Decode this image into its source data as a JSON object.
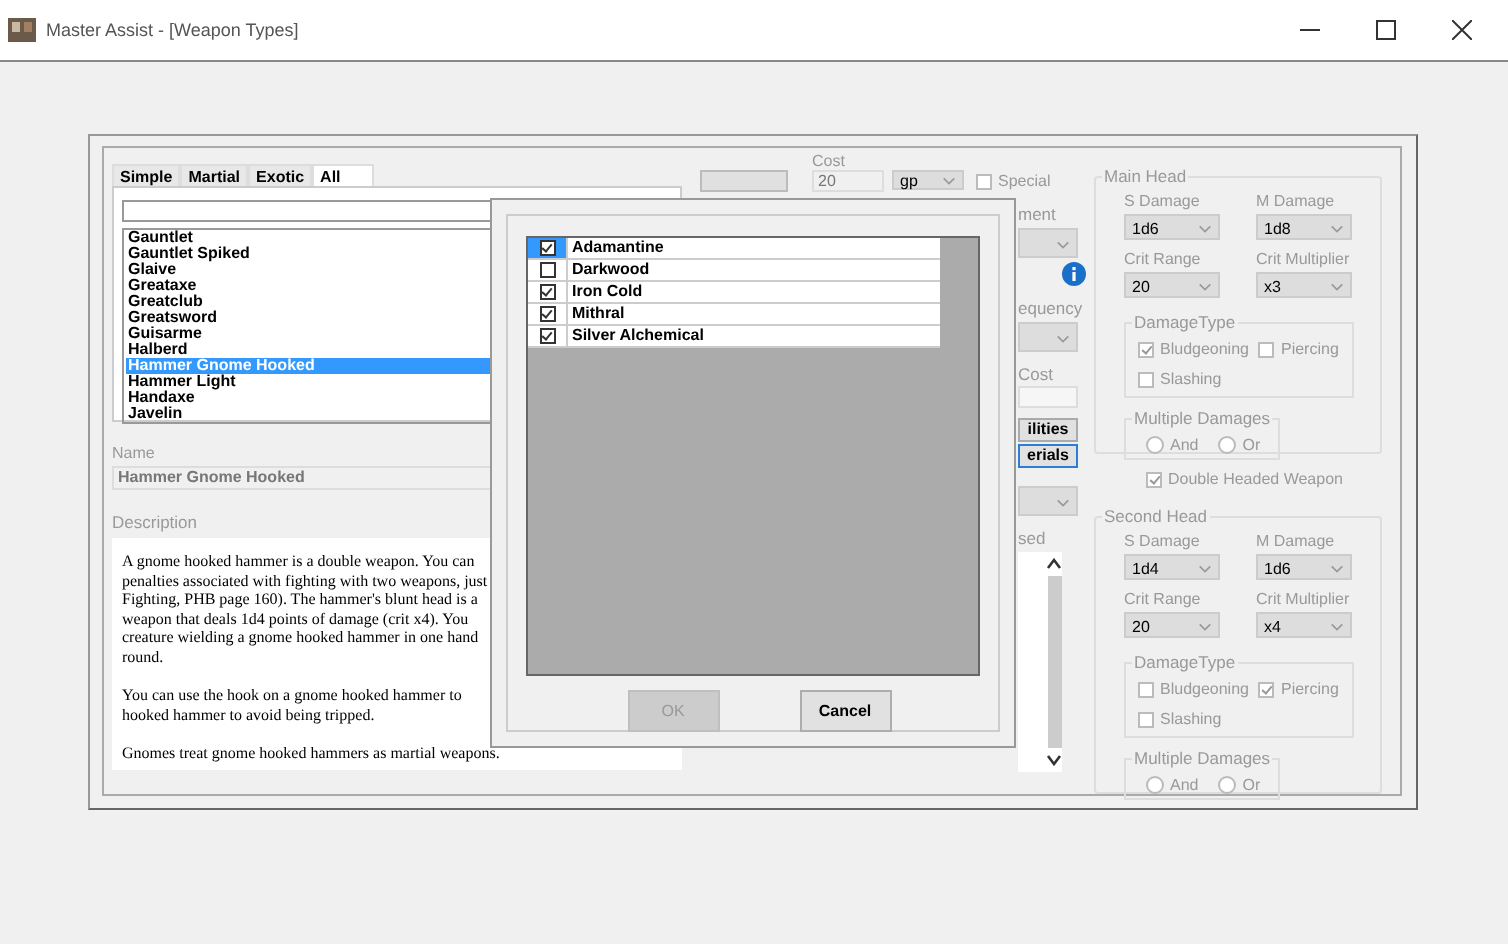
{
  "window": {
    "title": "Master Assist - [Weapon Types]"
  },
  "type_tabs": [
    {
      "label": "Simple",
      "selected": false
    },
    {
      "label": "Martial",
      "selected": false
    },
    {
      "label": "Exotic",
      "selected": false
    },
    {
      "label": "All",
      "selected": true
    }
  ],
  "weapon_list": [
    {
      "label": "Gauntlet",
      "selected": false
    },
    {
      "label": "Gauntlet Spiked",
      "selected": false
    },
    {
      "label": "Glaive",
      "selected": false
    },
    {
      "label": "Greataxe",
      "selected": false
    },
    {
      "label": "Greatclub",
      "selected": false
    },
    {
      "label": "Greatsword",
      "selected": false
    },
    {
      "label": "Guisarme",
      "selected": false
    },
    {
      "label": "Halberd",
      "selected": false
    },
    {
      "label": "Hammer Gnome Hooked",
      "selected": true
    },
    {
      "label": "Hammer Light",
      "selected": false
    },
    {
      "label": "Handaxe",
      "selected": false
    },
    {
      "label": "Javelin",
      "selected": false
    }
  ],
  "name": {
    "label": "Name",
    "value": "Hammer Gnome Hooked"
  },
  "description": {
    "label": "Description",
    "paragraphs": [
      [
        "A gnome hooked hammer is a double weapon.  You can",
        "penalties associated with fighting with two weapons, just",
        "Fighting, PHB page 160).  The hammer's blunt head is a",
        "weapon that deals 1d4 points of damage (crit x4).  You",
        "creature wielding a gnome hooked hammer in one hand",
        "round."
      ],
      [
        "You can use the hook on a gnome hooked hammer to",
        "hooked hammer to avoid being tripped."
      ],
      [
        "Gnomes treat gnome hooked hammers as martial weapons."
      ]
    ]
  },
  "cost": {
    "label": "Cost",
    "value": "20",
    "currency": "gp"
  },
  "special": {
    "label": "Special",
    "checked": false
  },
  "side_controls": [
    {
      "kind": "label",
      "text": "ment"
    },
    {
      "kind": "dropdown"
    },
    {
      "kind": "info"
    },
    {
      "kind": "label",
      "text": "equency"
    },
    {
      "kind": "dropdown"
    },
    {
      "kind": "label",
      "text": "Cost"
    },
    {
      "kind": "field"
    },
    {
      "kind": "button",
      "text": "ilities",
      "focused": false
    },
    {
      "kind": "button",
      "text": "erials",
      "focused": true
    },
    {
      "kind": "dropdown"
    },
    {
      "kind": "label",
      "text": "sed"
    },
    {
      "kind": "textarea"
    }
  ],
  "heads": [
    {
      "title": "Main Head",
      "s_damage": {
        "label": "S Damage",
        "value": "1d6"
      },
      "m_damage": {
        "label": "M Damage",
        "value": "1d8"
      },
      "crit_range": {
        "label": "Crit Range",
        "value": "20"
      },
      "crit_multiplier": {
        "label": "Crit Multiplier",
        "value": "x3"
      },
      "damage_type": {
        "title": "DamageType",
        "options": [
          {
            "label": "Bludgeoning",
            "checked": true
          },
          {
            "label": "Piercing",
            "checked": false
          },
          {
            "label": "Slashing",
            "checked": false
          }
        ]
      },
      "multiple_damages": {
        "title": "Multiple Damages",
        "options": [
          {
            "label": "And",
            "selected": false
          },
          {
            "label": "Or",
            "selected": false
          }
        ]
      }
    },
    {
      "title": "Second Head",
      "s_damage": {
        "label": "S Damage",
        "value": "1d4"
      },
      "m_damage": {
        "label": "M Damage",
        "value": "1d6"
      },
      "crit_range": {
        "label": "Crit Range",
        "value": "20"
      },
      "crit_multiplier": {
        "label": "Crit Multiplier",
        "value": "x4"
      },
      "damage_type": {
        "title": "DamageType",
        "options": [
          {
            "label": "Bludgeoning",
            "checked": false
          },
          {
            "label": "Piercing",
            "checked": true
          },
          {
            "label": "Slashing",
            "checked": false
          }
        ]
      },
      "multiple_damages": {
        "title": "Multiple Damages",
        "options": [
          {
            "label": "And",
            "selected": false
          },
          {
            "label": "Or",
            "selected": false
          }
        ]
      }
    }
  ],
  "double_headed": {
    "label": "Double Headed Weapon",
    "checked": true
  },
  "materials_dialog": {
    "items": [
      {
        "label": "Adamantine",
        "checked": true,
        "selected": true
      },
      {
        "label": "Darkwood",
        "checked": false,
        "selected": false
      },
      {
        "label": "Iron Cold",
        "checked": true,
        "selected": false
      },
      {
        "label": "Mithral",
        "checked": true,
        "selected": false
      },
      {
        "label": "Silver Alchemical",
        "checked": true,
        "selected": false
      }
    ],
    "buttons": [
      {
        "label": "OK",
        "disabled": true
      },
      {
        "label": "Cancel",
        "disabled": false
      }
    ]
  }
}
